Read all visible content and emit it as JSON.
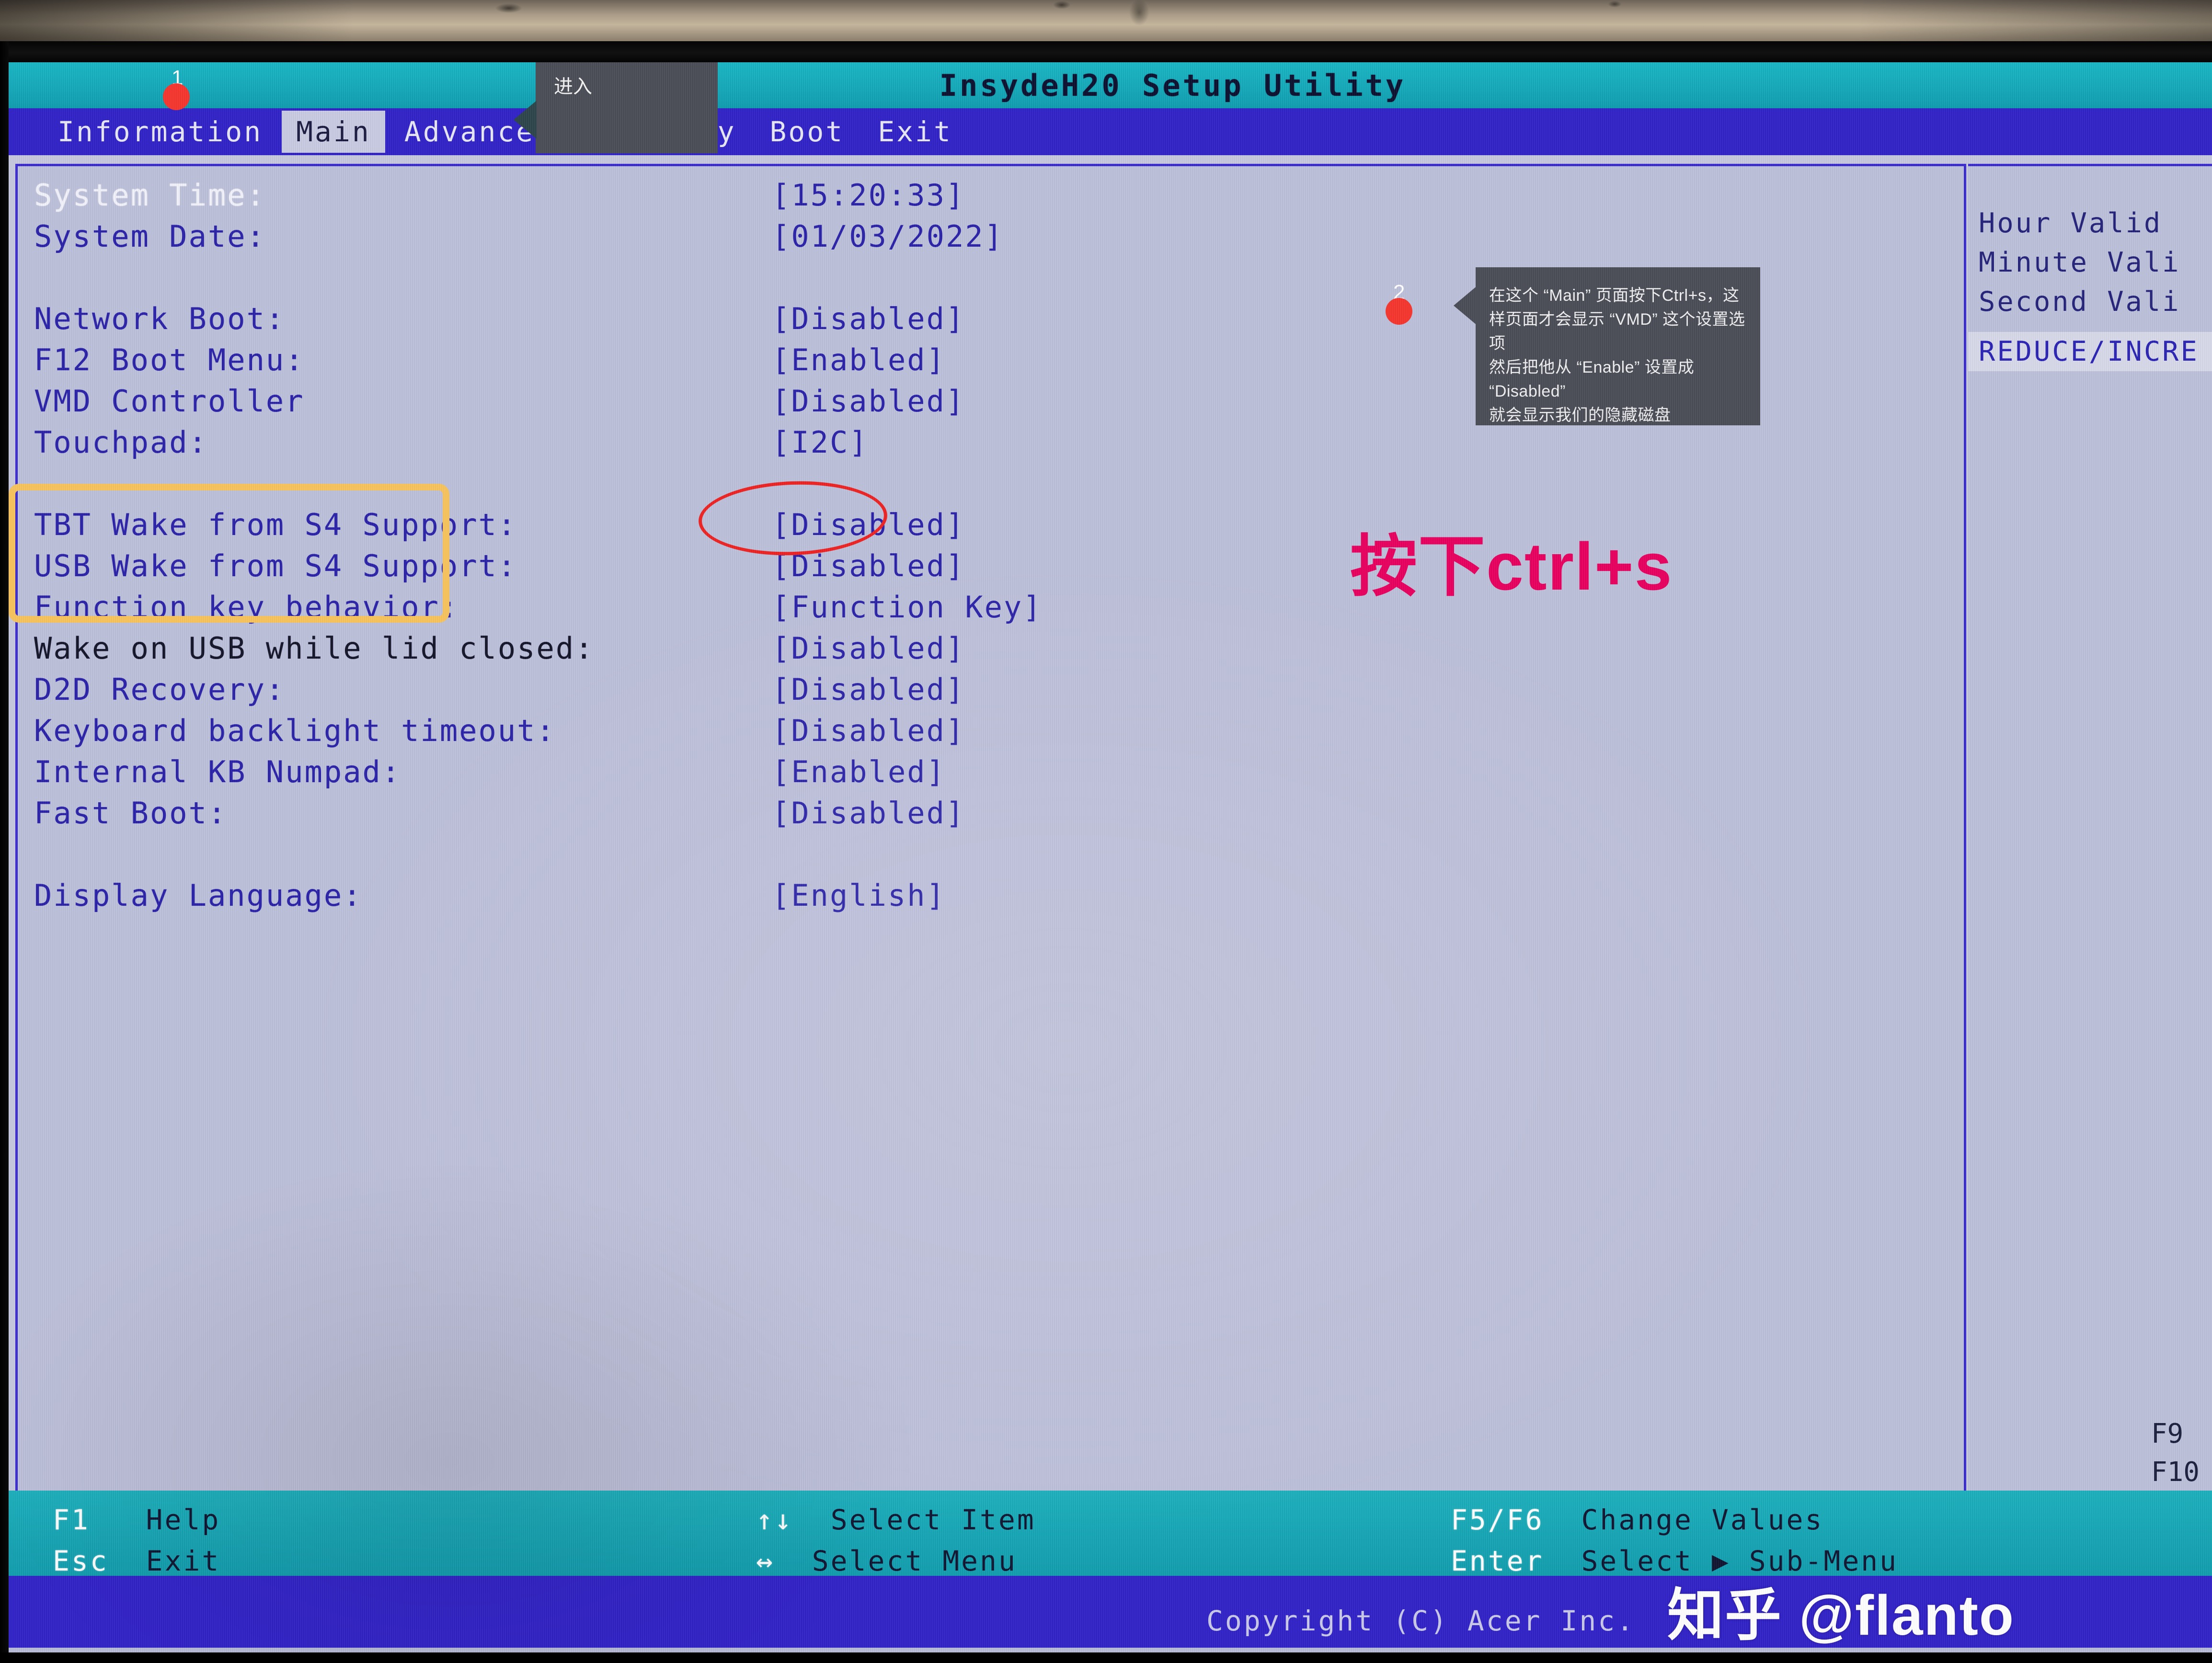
{
  "app": {
    "title": "InsydeH20 Setup Utility",
    "vendor_copyright": "Copyright (C) Acer Inc.",
    "accent_menu_bg": "#3122c8",
    "accent_title_bg": "#13a8b9",
    "screen_bg": "#bdc0da",
    "text_blue": "#2a22a8"
  },
  "menu": {
    "tabs": [
      {
        "label": "Information",
        "active": false
      },
      {
        "label": "Main",
        "active": true
      },
      {
        "label": "Advanced",
        "active": false
      },
      {
        "label": "Security",
        "active": false
      },
      {
        "label": "Boot",
        "active": false
      },
      {
        "label": "Exit",
        "active": false
      }
    ]
  },
  "settings": {
    "rows": [
      {
        "label": "System Time:",
        "value": "[15:20:33]",
        "style": "white"
      },
      {
        "label": "System Date:",
        "value": "[01/03/2022]",
        "style": "blue"
      },
      {
        "label": "",
        "value": "",
        "style": "gap"
      },
      {
        "label": "Network Boot:",
        "value": "[Disabled]",
        "style": "blue"
      },
      {
        "label": "F12 Boot Menu:",
        "value": "[Enabled]",
        "style": "blue"
      },
      {
        "label": "VMD Controller",
        "value": "[Disabled]",
        "style": "blue"
      },
      {
        "label": "Touchpad:",
        "value": "[I2C]",
        "style": "blue"
      },
      {
        "label": "",
        "value": "",
        "style": "gap"
      },
      {
        "label": "TBT Wake from S4 Support:",
        "value": "[Disabled]",
        "style": "blue"
      },
      {
        "label": "USB Wake from S4 Support:",
        "value": "[Disabled]",
        "style": "blue"
      },
      {
        "label": "Function key behavior:",
        "value": "[Function Key]",
        "style": "blue"
      },
      {
        "label": "Wake on USB while lid closed:",
        "value": "[Disabled]",
        "style": "dark"
      },
      {
        "label": "D2D Recovery:",
        "value": "[Disabled]",
        "style": "blue"
      },
      {
        "label": "Keyboard backlight timeout:",
        "value": "[Disabled]",
        "style": "blue"
      },
      {
        "label": " Internal KB Numpad:",
        "value": "[Enabled]",
        "style": "blue"
      },
      {
        "label": "Fast Boot:",
        "value": "[Disabled]",
        "style": "blue"
      },
      {
        "label": "",
        "value": "",
        "style": "gap"
      },
      {
        "label": "Display Language:",
        "value": "[English]",
        "style": "blue"
      }
    ]
  },
  "help_panel": {
    "lines": [
      "Hour Valid",
      "Minute Vali",
      "Second Vali"
    ],
    "highlight": "REDUCE/INCRE"
  },
  "footer": {
    "col1": [
      {
        "key": "F1",
        "label": "Help"
      },
      {
        "key": "Esc",
        "label": "Exit"
      }
    ],
    "col2": [
      {
        "key": "↑↓",
        "label": "Select Item"
      },
      {
        "key": "↔",
        "label": "Select Menu"
      }
    ],
    "col3": [
      {
        "key": "F5/F6",
        "label": "Change Values"
      },
      {
        "key": "Enter",
        "label": "Select ▶ Sub-Menu"
      }
    ],
    "col4": [
      {
        "key": "F9",
        "label": ""
      },
      {
        "key": "F10",
        "label": ""
      }
    ]
  },
  "annotations": {
    "highlight_box_target": "VMD Controller / Touchpad rows",
    "circle_target": "[Disabled]",
    "pink_note": "按下ctrl+s",
    "marker_one": "1",
    "marker_two": "2",
    "tip_small_label": "进入",
    "tip_big_lines": [
      "在这个 “Main” 页面按下Ctrl+s，这样页面才会显示 “VMD” 这个设置选项",
      "然后把他从 “Enable” 设置成 “Disabled”",
      "就会显示我们的隐藏磁盘"
    ],
    "watermark": "知乎 @flanto",
    "colors": {
      "highlight_box": "#f7c35c",
      "circle": "#ee2222",
      "pink_note": "#e8005f",
      "marker_dot": "#f5352e"
    }
  }
}
